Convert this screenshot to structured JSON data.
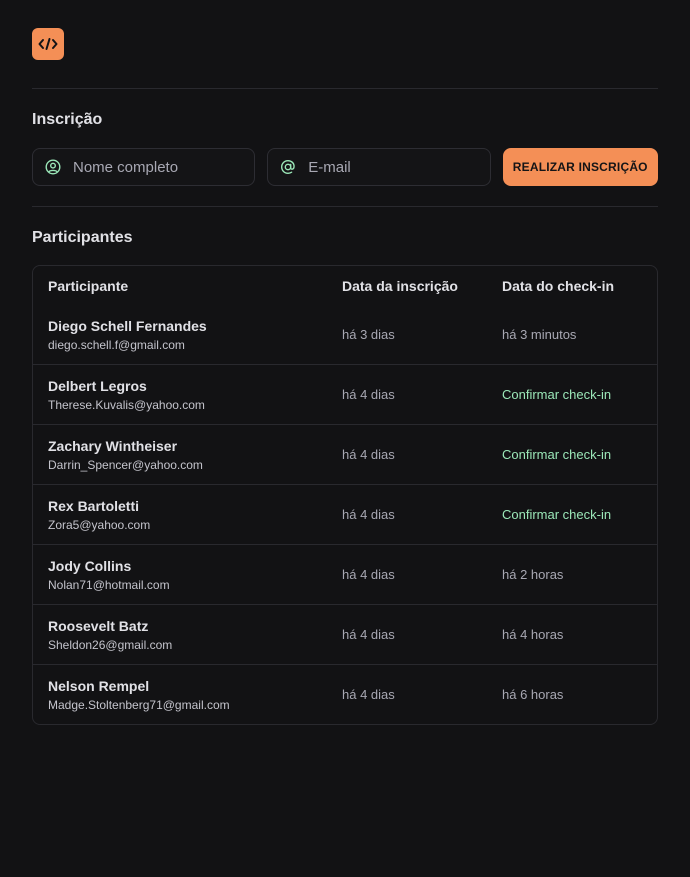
{
  "colors": {
    "background": "#121214",
    "accent": "#f48f56",
    "link": "#9be7b8",
    "border": "#29292e"
  },
  "logo": {
    "icon": "code-icon",
    "text": "</>"
  },
  "form": {
    "title": "Inscrição",
    "name_placeholder": "Nome completo",
    "email_placeholder": "E-mail",
    "submit_label": "REALIZAR INSCRIÇÃO",
    "name_icon": "user-circle-icon",
    "email_icon": "at-sign-icon"
  },
  "list": {
    "title": "Participantes",
    "columns": [
      "Participante",
      "Data da inscrição",
      "Data do check-in"
    ],
    "rows": [
      {
        "name": "Diego Schell Fernandes",
        "email": "diego.schell.f@gmail.com",
        "registered": "há 3 dias",
        "checkin": "há 3 minutos",
        "checkin_action": false
      },
      {
        "name": "Delbert Legros",
        "email": "Therese.Kuvalis@yahoo.com",
        "registered": "há 4 dias",
        "checkin": "Confirmar check-in",
        "checkin_action": true
      },
      {
        "name": "Zachary Wintheiser",
        "email": "Darrin_Spencer@yahoo.com",
        "registered": "há 4 dias",
        "checkin": "Confirmar check-in",
        "checkin_action": true
      },
      {
        "name": "Rex Bartoletti",
        "email": "Zora5@yahoo.com",
        "registered": "há 4 dias",
        "checkin": "Confirmar check-in",
        "checkin_action": true
      },
      {
        "name": "Jody Collins",
        "email": "Nolan71@hotmail.com",
        "registered": "há 4 dias",
        "checkin": "há 2 horas",
        "checkin_action": false
      },
      {
        "name": "Roosevelt Batz",
        "email": "Sheldon26@gmail.com",
        "registered": "há 4 dias",
        "checkin": "há 4 horas",
        "checkin_action": false
      },
      {
        "name": "Nelson Rempel",
        "email": "Madge.Stoltenberg71@gmail.com",
        "registered": "há 4 dias",
        "checkin": "há 6 horas",
        "checkin_action": false
      }
    ]
  }
}
